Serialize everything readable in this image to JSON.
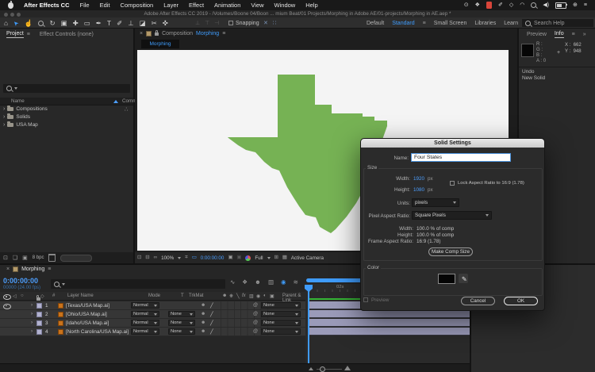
{
  "colors": {
    "accent_blue": "#3f9bfa",
    "state_green": "#76b254",
    "timecode_blue": "#4c9fff",
    "label_lavender": "#9b9bb9",
    "render_green": "#35b535"
  },
  "menu_bar": {
    "items": [
      "After Effects CC",
      "File",
      "Edit",
      "Composition",
      "Layer",
      "Effect",
      "Animation",
      "View",
      "Window",
      "Help"
    ],
    "status_icons": [
      {
        "name": "screen-mirroring-icon",
        "glyph": "⊙"
      },
      {
        "name": "dropbox-icon",
        "glyph": "❖"
      },
      {
        "name": "sketch-icon",
        "glyph": "✐"
      },
      {
        "name": "bluetooth-icon",
        "glyph": "◇"
      },
      {
        "name": "wifi-icon",
        "glyph": "◠"
      },
      {
        "name": "volume-icon",
        "glyph": "◀)"
      },
      {
        "name": "globe-icon",
        "glyph": "⊕"
      },
      {
        "name": "control-center-icon",
        "glyph": "≡"
      }
    ]
  },
  "title_bar": {
    "title": "Adobe After Effects CC 2019 - /Volumes/Boone 04/Boon ... mium Beat/01 Projects/Morphing in Adobe AE/01-projects/Morphing in AE.aep *"
  },
  "toolbar": {
    "tools": [
      {
        "name": "home-tool",
        "glyph": "⌂"
      },
      {
        "name": "selection-tool",
        "glyph": "➤"
      },
      {
        "name": "hand-tool",
        "glyph": "☝"
      },
      {
        "name": "zoom-tool",
        "glyph": ""
      },
      {
        "name": "rotate-tool",
        "glyph": "↻"
      },
      {
        "name": "camera-tool",
        "glyph": "▣"
      },
      {
        "name": "pan-behind-tool",
        "glyph": "✚"
      },
      {
        "name": "shape-tool",
        "glyph": "▭"
      },
      {
        "name": "pen-tool",
        "glyph": "✒"
      },
      {
        "name": "type-tool",
        "glyph": "T"
      },
      {
        "name": "brush-tool",
        "glyph": "✐"
      },
      {
        "name": "stamp-tool",
        "glyph": "⊥"
      },
      {
        "name": "eraser-tool",
        "glyph": "◪"
      },
      {
        "name": "roto-brush-tool",
        "glyph": "✂"
      },
      {
        "name": "puppet-pin-tool",
        "glyph": "✜"
      }
    ],
    "align_icons": [
      {
        "name": "align-left-icon",
        "glyph": "⊥"
      },
      {
        "name": "align-center-icon",
        "glyph": "⊤"
      },
      {
        "name": "align-right-icon",
        "glyph": "⊣"
      }
    ],
    "snapping_label": "Snapping",
    "post_icons": [
      {
        "name": "pixel-snap-icon",
        "glyph": "✕"
      },
      {
        "name": "grid-snap-icon",
        "glyph": "∷"
      }
    ],
    "workspace_tabs": [
      "Default",
      "Standard",
      "Small Screen",
      "Libraries",
      "Learn"
    ],
    "overflow_glyph": "»",
    "search_label": "Search Help"
  },
  "project_panel": {
    "tabs": {
      "project": "Project",
      "effect_controls": "Effect Controls (none)"
    },
    "columns": {
      "name": "Name",
      "comment": "Comm"
    },
    "items": [
      {
        "label": "Compositions"
      },
      {
        "label": "Solids"
      },
      {
        "label": "USA Map"
      }
    ],
    "bit_depth": "8 bpc"
  },
  "comp_panel": {
    "tab_prefix": "Composition",
    "tab_name": "Morphing",
    "viewer_tab": "Morphing",
    "zoom": "100%",
    "timecode": "0:00:00:00",
    "resolution": "Full",
    "view": "Active Camera",
    "bar_icons": [
      {
        "name": "always-preview-icon",
        "glyph": "⊡"
      },
      {
        "name": "monitor-icon",
        "glyph": "⊟"
      },
      {
        "name": "view-options-glasses-icon",
        "glyph": "∞"
      },
      {
        "name": "ruler-icon",
        "glyph": "⌗"
      },
      {
        "name": "region-of-interest-icon",
        "glyph": "▭"
      },
      {
        "name": "snapshot-camera-icon",
        "glyph": "▣"
      },
      {
        "name": "show-snapshot-icon",
        "glyph": "▣"
      },
      {
        "name": "pixel-aspect-icon",
        "glyph": "⊞"
      },
      {
        "name": "grid-guides-icon",
        "glyph": "▦"
      }
    ]
  },
  "info_panel": {
    "tabs": {
      "preview": "Preview",
      "info": "Info"
    },
    "overflow_glyph": "»",
    "channels": {
      "r": "R :",
      "g": "G :",
      "b": "B :",
      "a": "A :",
      "a_value": "0"
    },
    "coords": {
      "x_label": "X :",
      "x_value": "662",
      "y_label": "Y :",
      "y_value": "948"
    },
    "history": [
      "Undo",
      "New Solid"
    ]
  },
  "dialog": {
    "title": "Solid Settings",
    "name_label": "Name:",
    "name_value": "Four States",
    "size_label": "Size",
    "width_label": "Width:",
    "width_value": "1920",
    "width_unit": "px",
    "height_label": "Height:",
    "height_value": "1080",
    "height_unit": "px",
    "lock_label": "Lock Aspect Ratio to 16:9 (1.78)",
    "units_label": "Units:",
    "units_value": "pixels",
    "par_label": "Pixel Aspect Ratio:",
    "par_value": "Square Pixels",
    "width_pct_label": "Width:",
    "width_pct_value": "100.0 % of comp",
    "height_pct_label": "Height:",
    "height_pct_value": "100.0 % of comp",
    "frame_ar_label": "Frame Aspect Ratio:",
    "frame_ar_value": "16:9 (1.78)",
    "make_comp_size_label": "Make Comp Size",
    "color_label": "Color",
    "preview_label": "Preview",
    "cancel_label": "Cancel",
    "ok_label": "OK"
  },
  "timeline": {
    "tab": "Morphing",
    "timecode": "0:00:00:00",
    "frame_info": "00000 (24.00 fps)",
    "ruler_labels": {
      "t0": "0s",
      "t2": "02s"
    },
    "option_icons": [
      {
        "name": "motion-path-icon",
        "glyph": "∿"
      },
      {
        "name": "wireframe-icon",
        "glyph": "❖"
      },
      {
        "name": "shy-guy-icon",
        "glyph": "☻"
      },
      {
        "name": "frame-blend-icon",
        "glyph": "▥"
      },
      {
        "name": "motion-blur-icon",
        "glyph": "◉"
      },
      {
        "name": "graph-editor-icon",
        "glyph": "≋"
      }
    ],
    "columns": {
      "number": "#",
      "layer_name": "Layer Name",
      "mode": "Mode",
      "t": "T",
      "trkmat": "TrkMat",
      "parent": "Parent & Link"
    },
    "switch_icons": [
      {
        "name": "shy-switch-icon",
        "glyph": "☻"
      },
      {
        "name": "collapse-switch-icon",
        "glyph": "❋"
      },
      {
        "name": "quality-switch-icon",
        "glyph": "╲"
      },
      {
        "name": "fx-switch-icon",
        "glyph": "fx"
      },
      {
        "name": "frame-blend-switch-icon",
        "glyph": "▥"
      },
      {
        "name": "motion-blur-switch-icon",
        "glyph": "◉"
      },
      {
        "name": "adjustment-switch-icon",
        "glyph": "◐"
      },
      {
        "name": "threed-switch-icon",
        "glyph": "▣"
      }
    ],
    "row_icons": {
      "shy": "☻",
      "quality": "╱",
      "pickwhip": "@"
    },
    "layers": [
      {
        "num": "1",
        "name": "[Texas/USA Map.ai]",
        "mode": "Normal",
        "trkmat": "",
        "parent": "None"
      },
      {
        "num": "2",
        "name": "[Ohio/USA Map.ai]",
        "mode": "Normal",
        "trkmat": "None",
        "parent": "None"
      },
      {
        "num": "3",
        "name": "[Idaho/USA Map.ai]",
        "mode": "Normal",
        "trkmat": "None",
        "parent": "None"
      },
      {
        "num": "4",
        "name": "[North Carolina/USA Map.ai]",
        "mode": "Normal",
        "trkmat": "None",
        "parent": "None"
      }
    ]
  },
  "project_bottom": {
    "icons": [
      {
        "name": "interpret-footage-icon",
        "glyph": "⊡"
      },
      {
        "name": "new-folder-icon",
        "glyph": "❏"
      },
      {
        "name": "new-composition-icon",
        "glyph": "▣"
      }
    ]
  }
}
